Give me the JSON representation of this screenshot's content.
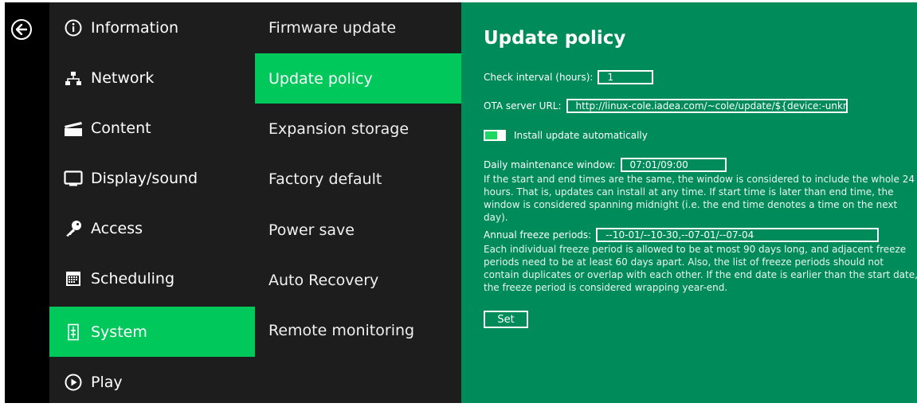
{
  "menu_primary": [
    {
      "label": "Information",
      "icon": "info-icon"
    },
    {
      "label": "Network",
      "icon": "network-icon"
    },
    {
      "label": "Content",
      "icon": "clapperboard-icon"
    },
    {
      "label": "Display/sound",
      "icon": "monitor-icon"
    },
    {
      "label": "Access",
      "icon": "key-icon"
    },
    {
      "label": "Scheduling",
      "icon": "calendar-icon"
    },
    {
      "label": "System",
      "icon": "system-icon"
    },
    {
      "label": "Play",
      "icon": "play-icon"
    }
  ],
  "menu_secondary": [
    {
      "label": "Firmware update"
    },
    {
      "label": "Update policy"
    },
    {
      "label": "Expansion storage"
    },
    {
      "label": "Factory default"
    },
    {
      "label": "Power save"
    },
    {
      "label": "Auto Recovery"
    },
    {
      "label": "Remote monitoring"
    }
  ],
  "active": {
    "primary": "System",
    "secondary": "Update policy"
  },
  "pane": {
    "title": "Update policy",
    "check_interval": {
      "label": "Check interval (hours):",
      "value": "1"
    },
    "ota_url": {
      "label": "OTA server URL:",
      "value": "http://linux-cole.iadea.com/~cole/update/${device:-unkn"
    },
    "auto_install": {
      "label": "Install update automatically",
      "enabled": true
    },
    "maintenance": {
      "label": "Daily maintenance window:",
      "value": "07:01/09:00",
      "help": "If the start and end times are the same, the window is considered to include the whole 24 hours. That is, updates can install at any time. If start time is later than end time, the window is considered spanning midnight (i.e. the end time denotes a time on the next day)."
    },
    "freeze": {
      "label": "Annual freeze periods:",
      "value": "--10-01/--10-30,--07-01/--07-04",
      "help": "Each individual freeze period is allowed to be at most 90 days long, and adjacent freeze periods need to be at least 60 days apart. Also, the list of freeze periods should not contain duplicates or overlap with each other. If the end date is earlier than the start date, the freeze period is considered wrapping year-end."
    },
    "set_label": "Set"
  },
  "colors": {
    "accent": "#00c85a",
    "pane_bg": "#008c5a",
    "menu_bg": "#1d1d1d",
    "rail_bg": "#000000"
  }
}
